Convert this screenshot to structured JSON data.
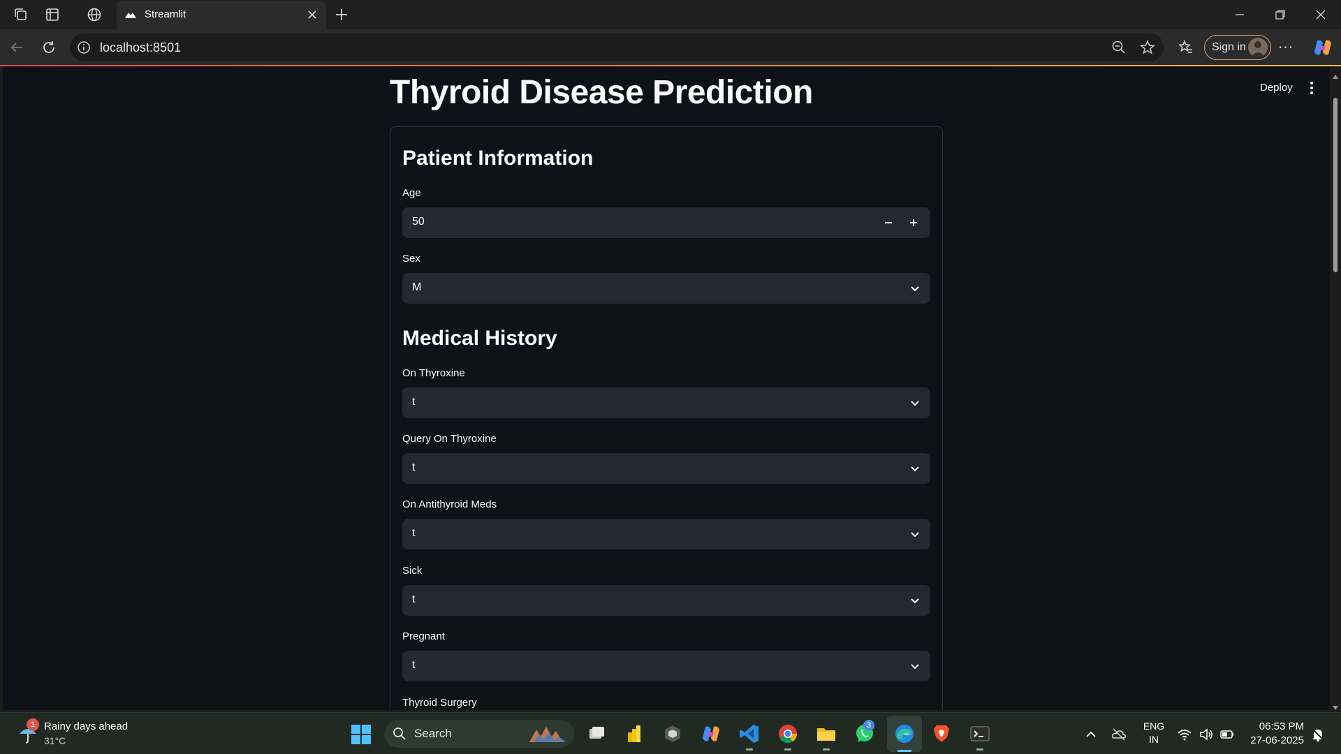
{
  "browser": {
    "tab_title": "Streamlit",
    "url": "localhost:8501",
    "signin_label": "Sign in",
    "more_label": "···"
  },
  "app": {
    "deploy_label": "Deploy",
    "title": "Thyroid Disease Prediction",
    "sections": {
      "patient": "Patient Information",
      "history": "Medical History"
    },
    "fields": {
      "age": {
        "label": "Age",
        "value": "50"
      },
      "sex": {
        "label": "Sex",
        "value": "M"
      },
      "on_thyroxine": {
        "label": "On Thyroxine",
        "value": "t"
      },
      "query_on_thyroxine": {
        "label": "Query On Thyroxine",
        "value": "t"
      },
      "on_antithyroid_meds": {
        "label": "On Antithyroid Meds",
        "value": "t"
      },
      "sick": {
        "label": "Sick",
        "value": "t"
      },
      "pregnant": {
        "label": "Pregnant",
        "value": "t"
      },
      "thyroid_surgery": {
        "label": "Thyroid Surgery"
      }
    }
  },
  "taskbar": {
    "weather": {
      "text": "Rainy days ahead",
      "temp": "31°C",
      "badge": "1"
    },
    "search_placeholder": "Search",
    "whatsapp_badge": "3",
    "lang": {
      "line1": "ENG",
      "line2": "IN"
    },
    "clock": {
      "time": "06:53 PM",
      "date": "27-06-2025"
    }
  },
  "colors": {
    "app_bg": "#0e1117",
    "control_bg": "#262730",
    "accent_line_start": "#ff4b4b",
    "accent_line_end": "#ffbd45"
  }
}
